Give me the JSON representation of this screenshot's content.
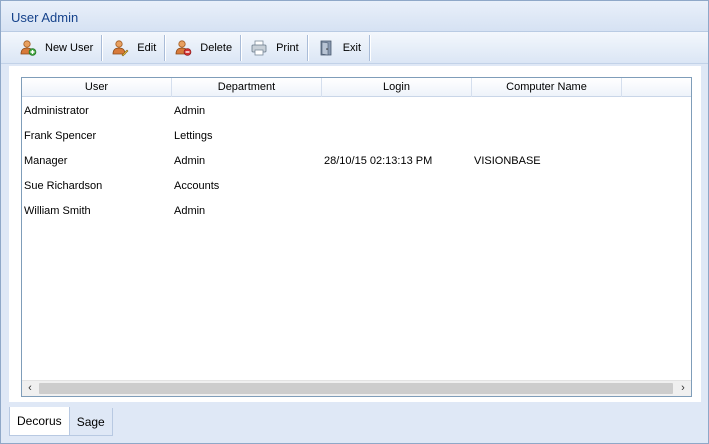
{
  "window": {
    "title": "User Admin"
  },
  "toolbar": {
    "buttons": [
      {
        "label": "New User",
        "icon": "user-add-icon"
      },
      {
        "label": "Edit",
        "icon": "user-edit-icon"
      },
      {
        "label": "Delete",
        "icon": "user-delete-icon"
      },
      {
        "label": "Print",
        "icon": "printer-icon"
      },
      {
        "label": "Exit",
        "icon": "exit-door-icon"
      }
    ]
  },
  "grid": {
    "columns": [
      "User",
      "Department",
      "Login",
      "Computer Name"
    ],
    "rows": [
      {
        "user": "Administrator",
        "department": "Admin",
        "login": "",
        "computer": ""
      },
      {
        "user": "Frank Spencer",
        "department": "Lettings",
        "login": "",
        "computer": ""
      },
      {
        "user": "Manager",
        "department": "Admin",
        "login": "28/10/15 02:13:13 PM",
        "computer": "VISIONBASE"
      },
      {
        "user": "Sue Richardson",
        "department": "Accounts",
        "login": "",
        "computer": ""
      },
      {
        "user": "William Smith",
        "department": "Admin",
        "login": "",
        "computer": ""
      }
    ],
    "scroll_left": "‹",
    "scroll_right": "›"
  },
  "tabs": [
    {
      "label": "Decorus",
      "active": true
    },
    {
      "label": "Sage",
      "active": false
    }
  ]
}
